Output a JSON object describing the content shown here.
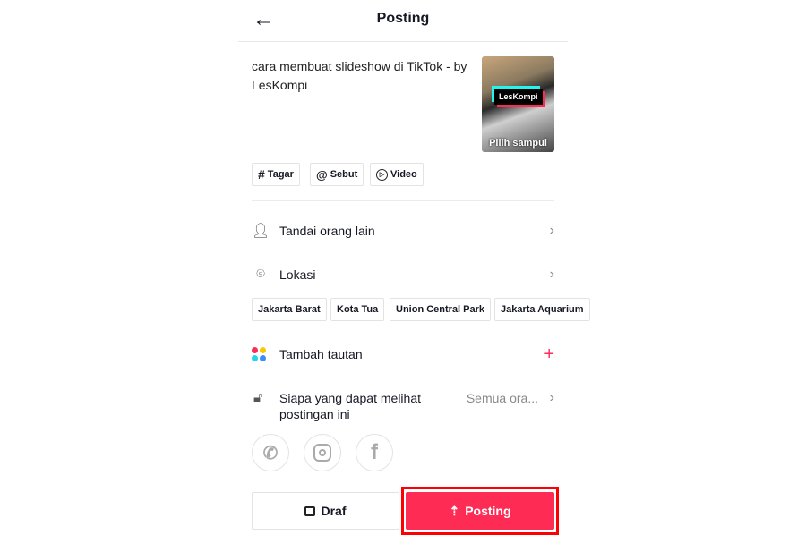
{
  "header": {
    "title": "Posting",
    "back_icon": "arrow-left-icon"
  },
  "caption": "cara membuat slideshow di TikTok - by LesKompi",
  "thumbnail": {
    "logo_text": "LesKompi",
    "label": "Pilih sampul"
  },
  "chips": [
    {
      "icon": "#",
      "label": "Tagar"
    },
    {
      "icon": "@",
      "label": "Sebut"
    },
    {
      "icon": "▷",
      "label": "Video"
    }
  ],
  "rows": {
    "tag": "Tandai orang lain",
    "location": "Lokasi",
    "link": "Tambah tautan",
    "privacy": "Siapa yang dapat melihat postingan ini",
    "privacy_value": "Semua ora..."
  },
  "locations": [
    "Jakarta Barat",
    "Kota Tua",
    "Union Central Park",
    "Jakarta Aquarium"
  ],
  "share": [
    "whatsapp",
    "instagram",
    "facebook"
  ],
  "buttons": {
    "draft": "Draf",
    "post": "Posting"
  },
  "colors": {
    "accent": "#fe2c55",
    "highlight": "#ff0000"
  }
}
